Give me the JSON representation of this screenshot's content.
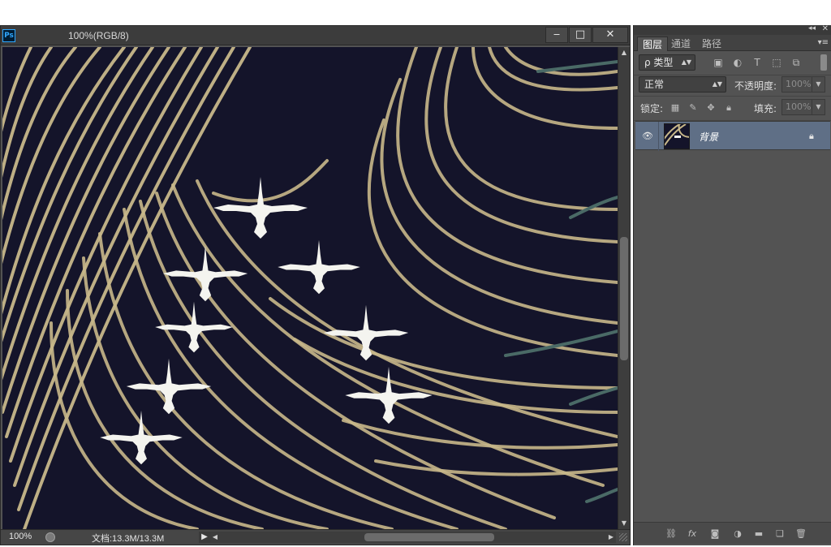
{
  "document": {
    "app_icon_label": "Ps",
    "title": "100%(RGB/8)",
    "window_buttons": {
      "minimize": "‒",
      "maximize": "□",
      "close": "✕"
    }
  },
  "status_bar": {
    "zoom": "100%",
    "doc_info": "文档:13.3M/13.3M",
    "arrow": "▶"
  },
  "panel": {
    "tabs": [
      {
        "label": "图层",
        "active": true
      },
      {
        "label": "通道",
        "active": false
      },
      {
        "label": "路径",
        "active": false
      }
    ],
    "filter": {
      "kind_label": "ρ 类型",
      "icons": [
        "image-filter-icon",
        "adjustment-filter-icon",
        "type-filter-icon",
        "shape-filter-icon",
        "smart-object-filter-icon"
      ]
    },
    "blend_mode": "正常",
    "opacity_label": "不透明度:",
    "opacity_value": "100%",
    "lock_label": "锁定:",
    "fill_label": "填充:",
    "fill_value": "100%",
    "layers": [
      {
        "name": "背景",
        "visible": true,
        "locked": true,
        "selected": true
      }
    ],
    "bottom_icons": [
      "link-layers-icon",
      "fx-icon",
      "mask-icon",
      "adjustment-layer-icon",
      "group-folder-icon",
      "new-layer-icon",
      "trash-icon"
    ]
  },
  "colors": {
    "chrome": "#535353",
    "canvas_bg": "#14142a",
    "gold_line": "#c8b88a",
    "teal_line": "#4a6a66",
    "selected_layer": "#5f6f86",
    "crane": "#f4f4ef"
  }
}
